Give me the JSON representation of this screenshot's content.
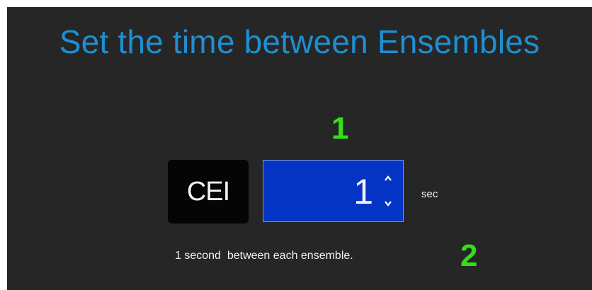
{
  "colors": {
    "background": "#262626",
    "title": "#1e8fd0",
    "annotation": "#33e014",
    "text": "#f2f2f2",
    "stepper_bg": "#0434c4",
    "cei_bg": "#050505"
  },
  "title": "Set the time between Ensembles",
  "annotations": {
    "one": "1",
    "two": "2"
  },
  "field": {
    "label": "CEI",
    "value": "1",
    "unit": "sec",
    "up_icon": "arrow-up-icon",
    "down_icon": "arrow-down-icon"
  },
  "description": "1 second  between each ensemble."
}
